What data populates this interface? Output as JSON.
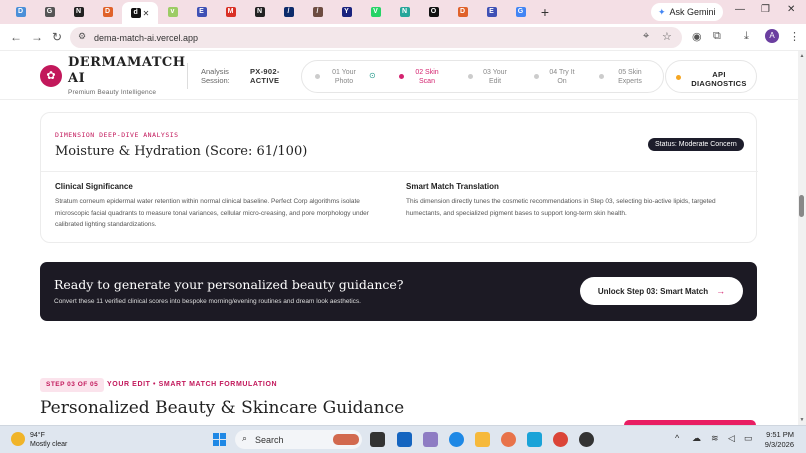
{
  "browser": {
    "tabs": [
      {
        "label": "D",
        "color": "#4a8fd8"
      },
      {
        "label": "G",
        "color": "#555"
      },
      {
        "label": "N",
        "color": "#222"
      },
      {
        "label": "D",
        "color": "#e0622a"
      },
      {
        "label": "d",
        "color": "#111",
        "active": true
      },
      {
        "label": "v",
        "color": "#9ccc65"
      },
      {
        "label": "E",
        "color": "#3f51b5"
      },
      {
        "label": "M",
        "color": "#d93025"
      },
      {
        "label": "N",
        "color": "#222"
      },
      {
        "label": "/",
        "color": "#0d2b6b"
      },
      {
        "label": "/",
        "color": "#6d4c41"
      },
      {
        "label": "Y",
        "color": "#1a237e"
      },
      {
        "label": "V",
        "color": "#25d366"
      },
      {
        "label": "N",
        "color": "#26a69a"
      },
      {
        "label": "O",
        "color": "#111"
      },
      {
        "label": "D",
        "color": "#e0622a"
      },
      {
        "label": "E",
        "color": "#3f51b5"
      },
      {
        "label": "G",
        "color": "#4285f4"
      }
    ],
    "new_tab": "+",
    "ask_gemini": "Ask Gemini",
    "url": "dema-match-ai.vercel.app",
    "avatar_letter": "A"
  },
  "app": {
    "brand_line1": "DERMAMATCH",
    "brand_line2": "AI",
    "tagline": "Premium Beauty Intelligence",
    "session_label": "Analysis Session:",
    "session_value": "PX-902-ACTIVE",
    "steps": [
      {
        "label": "01 Your Photo",
        "state": "done"
      },
      {
        "label": "02 Skin Scan",
        "state": "active"
      },
      {
        "label": "03 Your Edit",
        "state": "pending"
      },
      {
        "label": "04 Try It On",
        "state": "pending"
      },
      {
        "label": "05 Skin Experts",
        "state": "pending"
      }
    ],
    "api_button": "API DIAGNOSTICS",
    "card": {
      "kicker": "DIMENSION DEEP-DIVE ANALYSIS",
      "title": "Moisture & Hydration (Score: 61/100)",
      "status": "Status: Moderate Concern",
      "left_heading": "Clinical Significance",
      "left_text": "Stratum corneum epidermal water retention within normal clinical baseline. Perfect Corp algorithms isolate microscopic facial quadrants to measure tonal variances, cellular micro-creasing, and pore morphology under calibrated lighting standardizations.",
      "right_heading": "Smart Match Translation",
      "right_text": "This dimension directly tunes the cosmetic recommendations in Step 03, selecting bio-active lipids, targeted humectants, and specialized pigment bases to support long-term skin health."
    },
    "cta": {
      "heading": "Ready to generate your personalized beauty guidance?",
      "sub": "Convert these 11 verified clinical scores into bespoke morning/evening routines and dream look aesthetics.",
      "button": "Unlock Step 03: Smart Match",
      "arrow": "→"
    },
    "next_section": {
      "badge": "STEP 03 OF 05",
      "name": "YOUR EDIT • SMART MATCH FORMULATION",
      "title": "Personalized Beauty & Skincare Guidance"
    }
  },
  "taskbar": {
    "temp": "94°F",
    "weather": "Mostly clear",
    "search_placeholder": "Search",
    "time": "9:51 PM",
    "date": "9/3/2026"
  }
}
